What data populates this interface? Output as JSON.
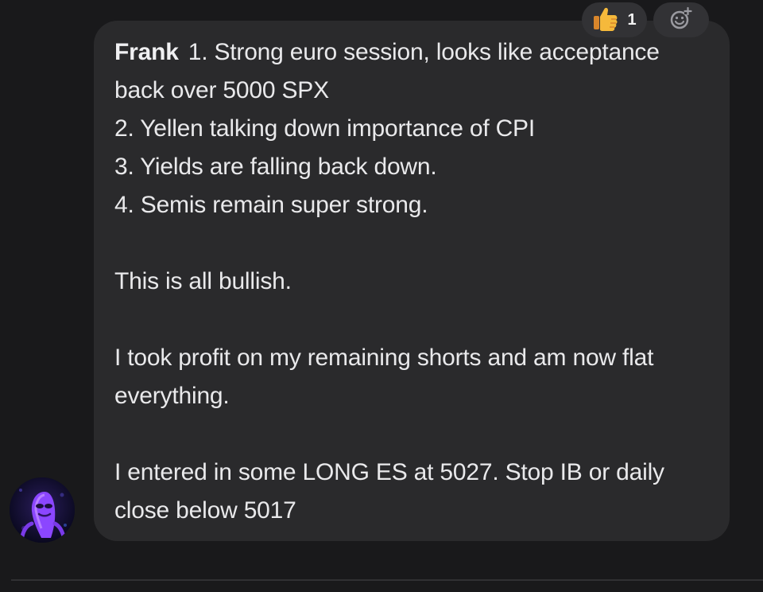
{
  "message": {
    "sender": "Frank",
    "lines": [
      "1. Strong euro session, looks like acceptance",
      "back over 5000 SPX",
      "2. Yellen talking down importance of CPI",
      "3. Yields are falling back down.",
      "4. Semis remain super strong.",
      "",
      "This is all bullish.",
      "",
      "I took profit on my remaining shorts and am now flat",
      "everything.",
      "",
      "I entered in some LONG ES at 5027. Stop IB or daily",
      "close below 5017"
    ]
  },
  "reactions": {
    "thumbs_up": {
      "icon": "thumbs-up-icon",
      "count": "1"
    },
    "add_reaction": {
      "icon": "add-reaction-icon"
    }
  },
  "colors": {
    "background": "#19191b",
    "bubble": "#2a2a2c",
    "text": "#e9e9eb",
    "reaction_pill": "#323235",
    "avatar_accent": "#8b46ff"
  }
}
